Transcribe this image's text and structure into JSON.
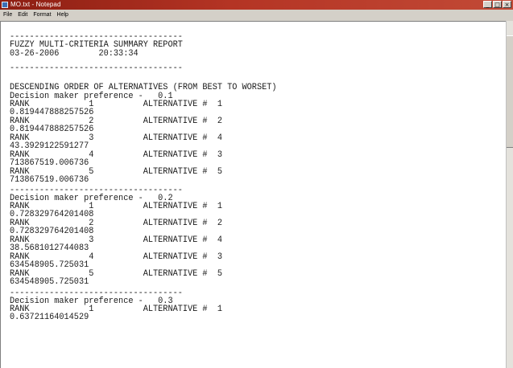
{
  "window": {
    "title": "MO.txt - Notepad",
    "controls": [
      "_",
      "□",
      "×"
    ]
  },
  "menu": [
    "File",
    "Edit",
    "Format",
    "Help"
  ],
  "document": {
    "lines": [
      "-----------------------------------",
      "FUZZY MULTI-CRITERIA SUMMARY REPORT",
      "03-26-2006        20:33:34",
      "-----------------------------------",
      "",
      "DESCENDING ORDER OF ALTERNATIVES (FROM BEST TO WORSET)",
      "Decision maker preference -   0.1",
      "RANK            1          ALTERNATIVE #  1",
      "0.819447888257526",
      "RANK            2          ALTERNATIVE #  2",
      "0.819447888257526",
      "RANK            3          ALTERNATIVE #  4",
      "43.3929122591277",
      "RANK            4          ALTERNATIVE #  3",
      "713867519.006736",
      "RANK            5          ALTERNATIVE #  5",
      "713867519.006736",
      "-----------------------------------",
      "Decision maker preference -   0.2",
      "RANK            1          ALTERNATIVE #  1",
      "0.728329764201408",
      "RANK            2          ALTERNATIVE #  2",
      "0.728329764201408",
      "RANK            3          ALTERNATIVE #  4",
      "38.5681012744083",
      "RANK            4          ALTERNATIVE #  3",
      "634548905.725031",
      "RANK            5          ALTERNATIVE #  5",
      "634548905.725031",
      "-----------------------------------",
      "Decision maker preference -   0.3",
      "RANK            1          ALTERNATIVE #  1",
      "0.63721164014529"
    ]
  }
}
